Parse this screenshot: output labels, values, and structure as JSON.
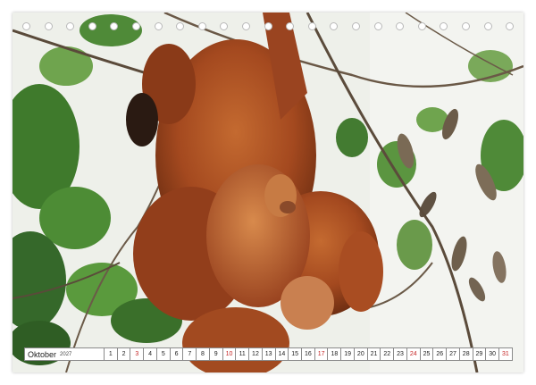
{
  "calendar": {
    "month": "Oktober",
    "year": "2027",
    "days": [
      {
        "n": "1",
        "red": false
      },
      {
        "n": "2",
        "red": false
      },
      {
        "n": "3",
        "red": true
      },
      {
        "n": "4",
        "red": false
      },
      {
        "n": "5",
        "red": false
      },
      {
        "n": "6",
        "red": false
      },
      {
        "n": "7",
        "red": false
      },
      {
        "n": "8",
        "red": false
      },
      {
        "n": "9",
        "red": false
      },
      {
        "n": "10",
        "red": true
      },
      {
        "n": "11",
        "red": false
      },
      {
        "n": "12",
        "red": false
      },
      {
        "n": "13",
        "red": false
      },
      {
        "n": "14",
        "red": false
      },
      {
        "n": "15",
        "red": false
      },
      {
        "n": "16",
        "red": false
      },
      {
        "n": "17",
        "red": true
      },
      {
        "n": "18",
        "red": false
      },
      {
        "n": "19",
        "red": false
      },
      {
        "n": "20",
        "red": false
      },
      {
        "n": "21",
        "red": false
      },
      {
        "n": "22",
        "red": false
      },
      {
        "n": "23",
        "red": false
      },
      {
        "n": "24",
        "red": true
      },
      {
        "n": "25",
        "red": false
      },
      {
        "n": "26",
        "red": false
      },
      {
        "n": "27",
        "red": false
      },
      {
        "n": "28",
        "red": false
      },
      {
        "n": "29",
        "red": false
      },
      {
        "n": "30",
        "red": false
      },
      {
        "n": "31",
        "red": true
      }
    ],
    "holiday_color": "#c62828"
  },
  "photo": {
    "subject": "orangutan-mother-with-infant",
    "fur_color": "#a4491f",
    "foliage_color": "#3f7a2c",
    "sky_color": "#eef0ea"
  }
}
